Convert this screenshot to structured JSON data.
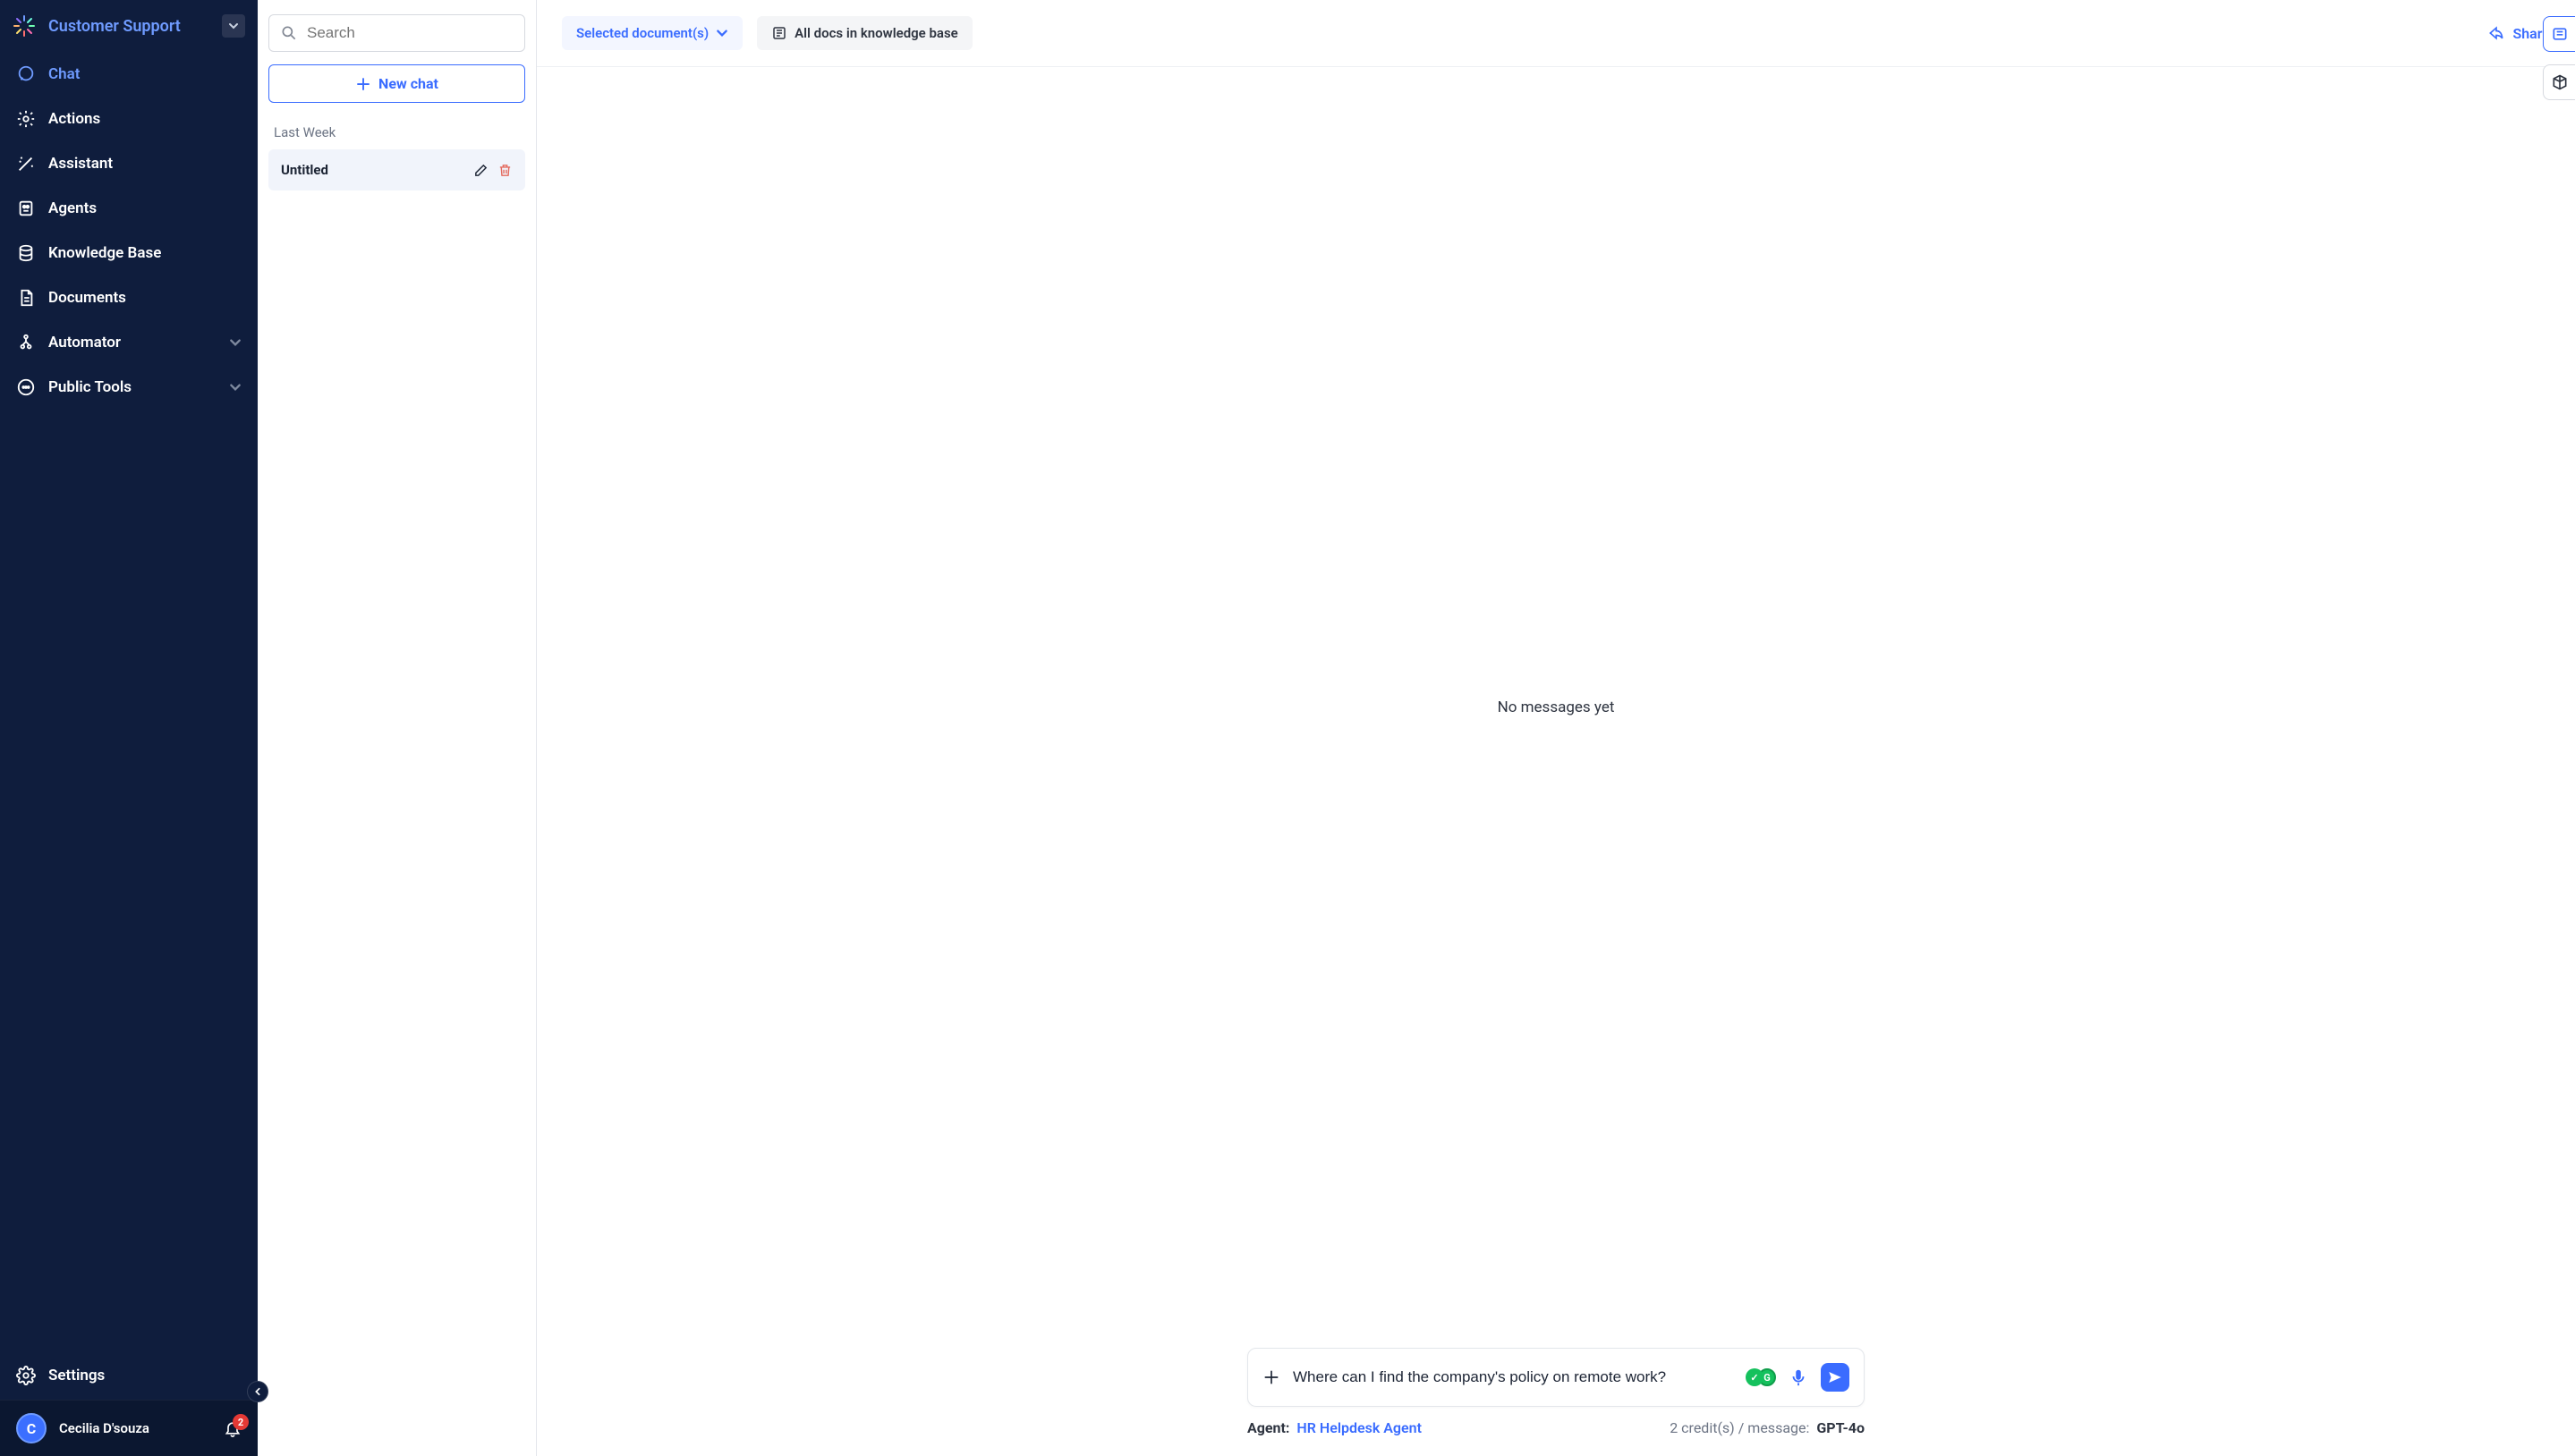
{
  "workspace": {
    "title": "Customer Support"
  },
  "sidebar": {
    "items": [
      {
        "label": "Chat",
        "icon": "chat-icon",
        "active": true,
        "expandable": false
      },
      {
        "label": "Actions",
        "icon": "gear-icon",
        "active": false,
        "expandable": false
      },
      {
        "label": "Assistant",
        "icon": "wand-icon",
        "active": false,
        "expandable": false
      },
      {
        "label": "Agents",
        "icon": "agents-icon",
        "active": false,
        "expandable": false
      },
      {
        "label": "Knowledge Base",
        "icon": "database-icon",
        "active": false,
        "expandable": false
      },
      {
        "label": "Documents",
        "icon": "document-icon",
        "active": false,
        "expandable": false
      },
      {
        "label": "Automator",
        "icon": "automator-icon",
        "active": false,
        "expandable": true
      },
      {
        "label": "Public Tools",
        "icon": "tools-icon",
        "active": false,
        "expandable": true
      }
    ],
    "settings_label": "Settings"
  },
  "user": {
    "name": "Cecilia D'souza",
    "initial": "C",
    "notifications": "2"
  },
  "chatlist": {
    "search_placeholder": "Search",
    "new_chat_label": "New chat",
    "group_label": "Last Week",
    "chats": [
      {
        "title": "Untitled"
      }
    ]
  },
  "topbar": {
    "selected_docs_label": "Selected document(s)",
    "all_docs_label": "All docs in knowledge base",
    "share_label": "Share"
  },
  "chat": {
    "empty_message": "No messages yet"
  },
  "composer": {
    "value": "Where can I find the company's policy on remote work?"
  },
  "meta": {
    "agent_label": "Agent:",
    "agent_name": "HR Helpdesk Agent",
    "credits_text": "2 credit(s) / message:",
    "model": "GPT-4o"
  }
}
